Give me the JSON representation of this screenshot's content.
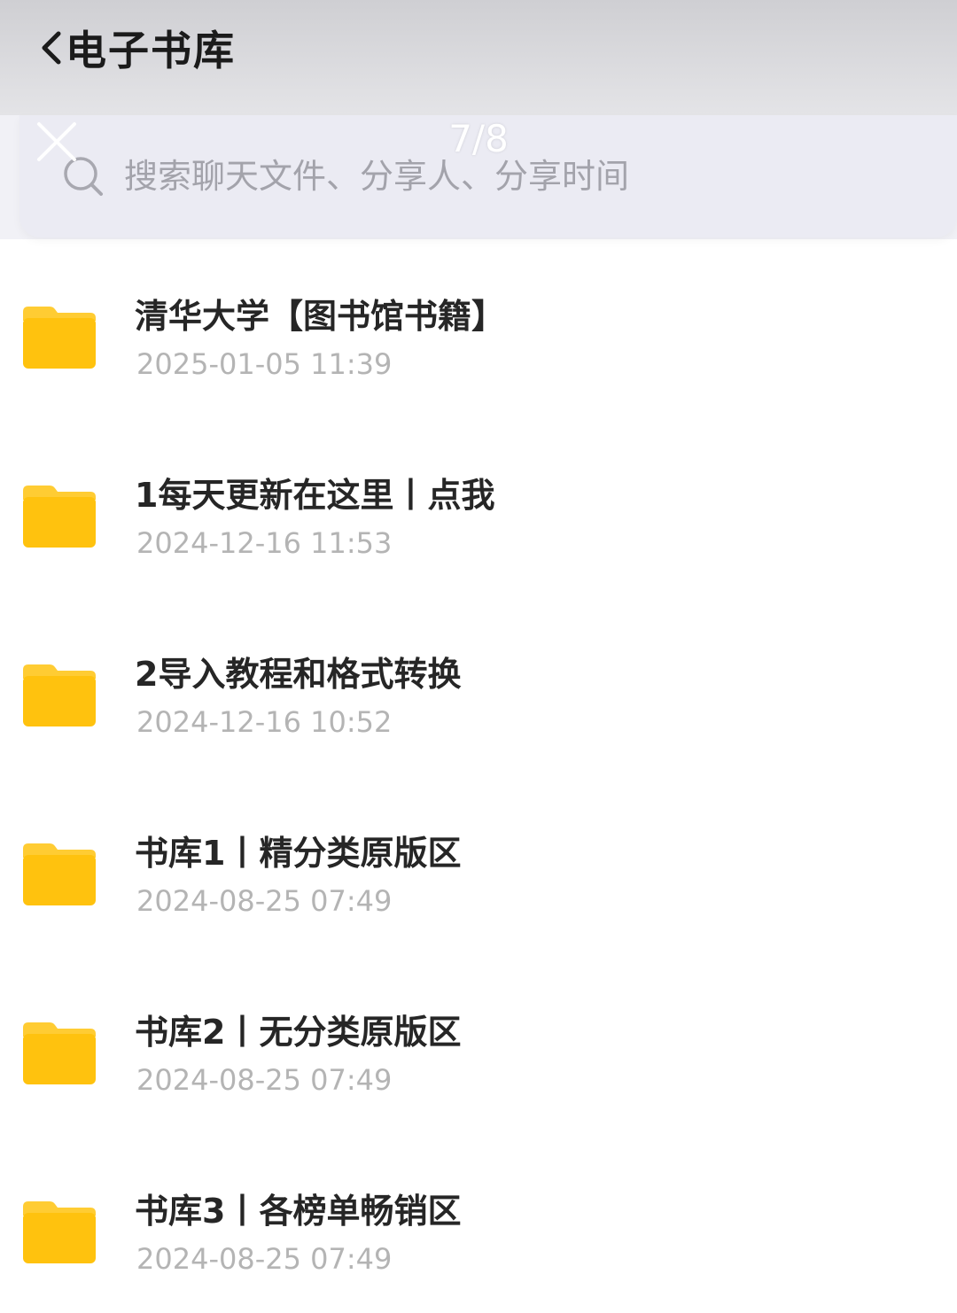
{
  "header": {
    "title": "电子书库",
    "back_icon": "chevron-left-icon"
  },
  "search": {
    "placeholder": "搜索聊天文件、分享人、分享时间",
    "icon": "search-icon"
  },
  "overlay": {
    "counter": "7/8",
    "close_icon": "close-icon"
  },
  "colors": {
    "folder": "#ffc20e",
    "folder_tab": "#ffca2c",
    "title_text": "#262626",
    "date_text": "#b4b4b4"
  },
  "files": [
    {
      "name": "清华大学【图书馆书籍】",
      "date": "2025-01-05 11:39"
    },
    {
      "name": "1每天更新在这里丨点我",
      "date": "2024-12-16 11:53"
    },
    {
      "name": "2导入教程和格式转换",
      "date": "2024-12-16 10:52"
    },
    {
      "name": "书库1丨精分类原版区",
      "date": "2024-08-25 07:49"
    },
    {
      "name": "书库2丨无分类原版区",
      "date": "2024-08-25 07:49"
    },
    {
      "name": "书库3丨各榜单畅销区",
      "date": "2024-08-25 07:49"
    }
  ]
}
